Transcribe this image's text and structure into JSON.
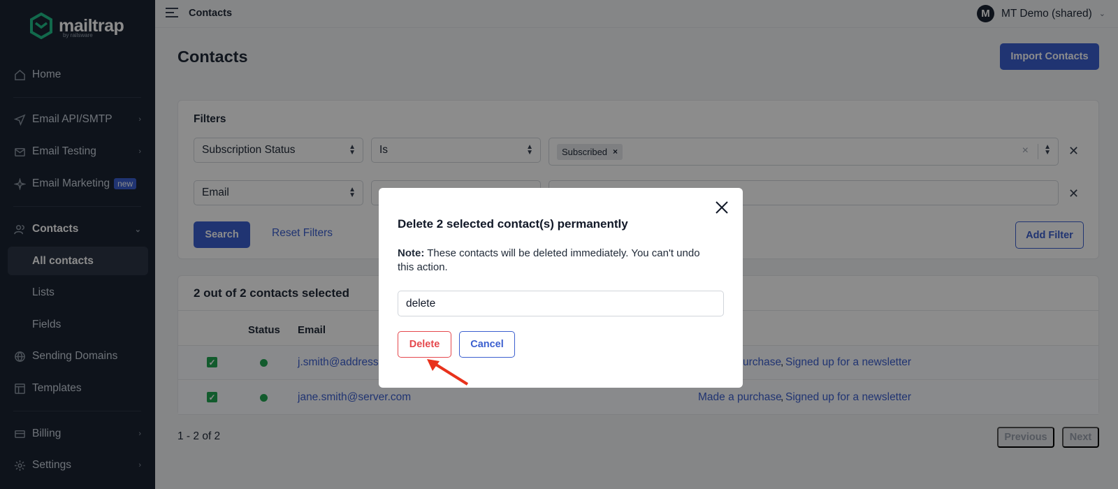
{
  "sidebar": {
    "logo_text": "mailtrap",
    "logo_sub": "by railsware",
    "items": [
      {
        "label": "Home",
        "icon": "home-icon"
      },
      {
        "label": "Email API/SMTP",
        "icon": "send-icon"
      },
      {
        "label": "Email Testing",
        "icon": "mail-check-icon"
      },
      {
        "label": "Email Marketing",
        "icon": "sparkle-icon",
        "badge": "new"
      },
      {
        "label": "Contacts",
        "icon": "users-icon"
      },
      {
        "label": "All contacts"
      },
      {
        "label": "Lists"
      },
      {
        "label": "Fields"
      },
      {
        "label": "Sending Domains",
        "icon": "globe-icon"
      },
      {
        "label": "Templates",
        "icon": "template-icon"
      },
      {
        "label": "Billing",
        "icon": "card-icon"
      },
      {
        "label": "Settings",
        "icon": "gear-icon"
      }
    ]
  },
  "topbar": {
    "breadcrumb": "Contacts",
    "avatar_initial": "M",
    "account_name": "MT Demo (shared)"
  },
  "main": {
    "title": "Contacts",
    "import_button": "Import Contacts",
    "filters": {
      "title": "Filters",
      "rows": [
        {
          "field": "Subscription Status",
          "operator": "Is",
          "value_tag": "Subscribed"
        },
        {
          "field": "Email",
          "operator": "",
          "value_tag": ""
        }
      ],
      "search_button": "Search",
      "reset_button": "Reset Filters",
      "add_filter_button": "Add Filter"
    },
    "table": {
      "selected_text": "2 out of 2 contacts selected",
      "headers": [
        "Status",
        "Email"
      ],
      "rows": [
        {
          "email": "j.smith@address.",
          "event1": "urchase",
          "event2": "Signed up for a newsletter"
        },
        {
          "email": "jane.smith@server.com",
          "event1": "Made a purchase",
          "event2": "Signed up for a newsletter"
        }
      ]
    },
    "pager": {
      "text": "1 - 2 of 2",
      "previous": "Previous",
      "next": "Next"
    }
  },
  "modal": {
    "title": "Delete 2 selected contact(s) permanently",
    "note_label": "Note:",
    "note_text": " These contacts will be deleted immediately. You can't undo this action.",
    "input_value": "delete",
    "delete_button": "Delete",
    "cancel_button": "Cancel"
  },
  "colors": {
    "sidebar_bg": "#1a2332",
    "accent": "#3b5fcf",
    "danger": "#e5484d",
    "success": "#22a653",
    "annotation_arrow": "#e8321c"
  }
}
